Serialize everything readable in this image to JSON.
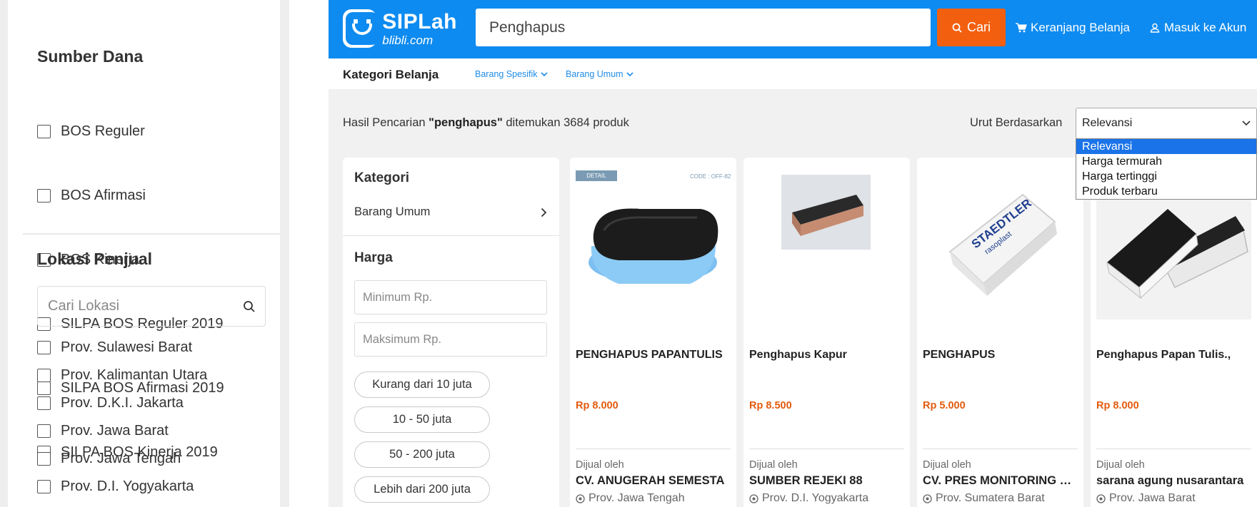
{
  "left_panel": {
    "funding_title": "Sumber Dana",
    "funding_options": [
      {
        "label": "BOS Reguler"
      },
      {
        "label": "BOS Afirmasi"
      },
      {
        "label": "BOS Kinerja"
      },
      {
        "label": "SILPA BOS Reguler 2019"
      },
      {
        "label": "SILPA BOS Afirmasi 2019"
      },
      {
        "label": "SILPA BOS Kinerja 2019"
      }
    ],
    "location_title": "Lokasi Penjual",
    "location_search_placeholder": "Cari Lokasi",
    "location_options": [
      {
        "label": "Prov. Sulawesi Barat"
      },
      {
        "label": "Prov. Kalimantan Utara"
      },
      {
        "label": "Prov. D.K.I. Jakarta"
      },
      {
        "label": "Prov. Jawa Barat"
      },
      {
        "label": "Prov. Jawa Tengah"
      },
      {
        "label": "Prov. D.I. Yogyakarta"
      }
    ]
  },
  "header": {
    "logo_title": "SIPLah",
    "logo_subtitle": "blibli.com",
    "search_value": "Penghapus",
    "search_button": "Cari",
    "cart_link": "Keranjang Belanja",
    "login_link": "Masuk ke Akun",
    "brand_color": "#0e8bf0",
    "accent_color": "#f2600f"
  },
  "category_bar": {
    "title": "Kategori Belanja",
    "links": [
      {
        "label": "Barang Spesifik"
      },
      {
        "label": "Barang Umum"
      }
    ]
  },
  "results": {
    "prefix": "Hasil Pencarian ",
    "query": "\"penghapus\"",
    "suffix": " ditemukan 3684 produk",
    "sort_label": "Urut Berdasarkan",
    "sort_selected": "Relevansi",
    "sort_options": [
      "Relevansi",
      "Harga termurah",
      "Harga tertinggi",
      "Produk terbaru"
    ]
  },
  "filter": {
    "category_title": "Kategori",
    "category_item": "Barang Umum",
    "price_title": "Harga",
    "min_placeholder": "Minimum Rp.",
    "max_placeholder": "Maksimum Rp.",
    "ranges": [
      "Kurang dari 10 juta",
      "10 - 50 juta",
      "50 - 200 juta",
      "Lebih dari 200 juta"
    ]
  },
  "products": [
    {
      "name": "PENGHAPUS PAPANTULIS",
      "price": "Rp 8.000",
      "sold_by": "Dijual oleh",
      "seller": "CV. ANUGERAH SEMESTA",
      "location": "Prov. Jawa Tengah",
      "image_tag": "DETAIL",
      "image_code": "CODE : OFF-82",
      "image_icon": "whiteboard-eraser-blue"
    },
    {
      "name": "Penghapus Kapur",
      "price": "Rp 8.500",
      "sold_by": "Dijual oleh",
      "seller": "SUMBER REJEKI 88",
      "location": "Prov. D.I. Yogyakarta",
      "image_icon": "chalk-eraser"
    },
    {
      "name": "PENGHAPUS",
      "price": "Rp 5.000",
      "sold_by": "Dijual oleh",
      "seller": "CV. PRES MONITORING …",
      "location": "Prov. Sumatera Barat",
      "image_icon": "staedtler-eraser",
      "image_brand": "STAEDTLER",
      "image_model": "rasoplast"
    },
    {
      "name": "Penghapus Papan Tulis.,",
      "price": "Rp 8.000",
      "sold_by": "Dijual oleh",
      "seller": "sarana agung nusarantara",
      "location": "Prov. Jawa Barat",
      "image_icon": "whiteboard-eraser-white"
    }
  ]
}
